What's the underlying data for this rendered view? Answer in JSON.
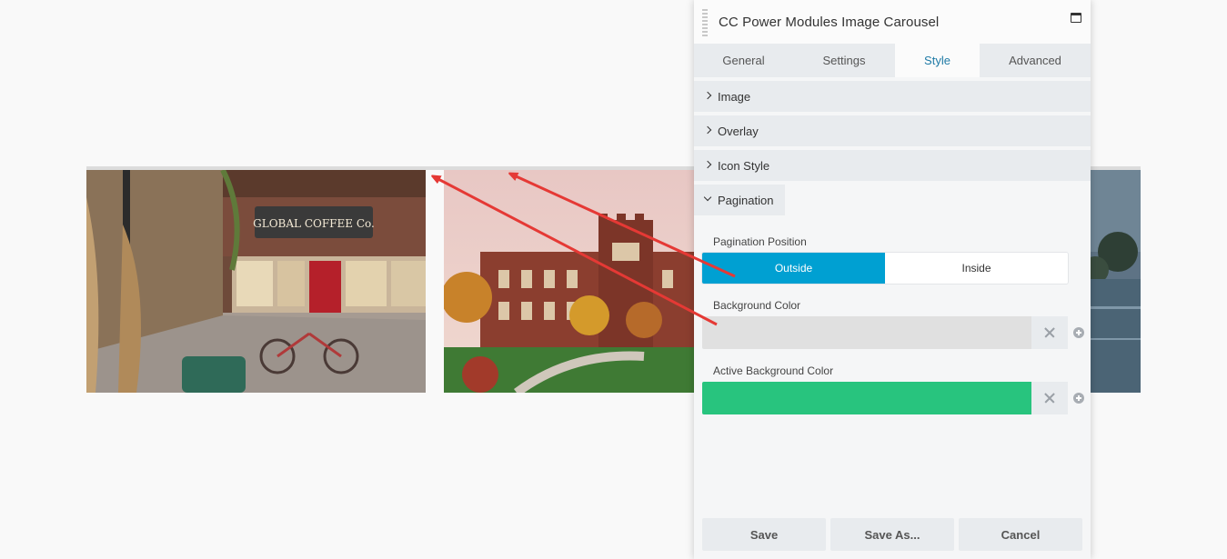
{
  "panel": {
    "title": "CC Power Modules Image Carousel",
    "tabs": [
      {
        "label": "General"
      },
      {
        "label": "Settings"
      },
      {
        "label": "Style",
        "active": true
      },
      {
        "label": "Advanced"
      }
    ],
    "sections": [
      {
        "label": "Image",
        "expanded": false
      },
      {
        "label": "Overlay",
        "expanded": false
      },
      {
        "label": "Icon Style",
        "expanded": false
      },
      {
        "label": "Pagination",
        "expanded": true
      }
    ],
    "pagination": {
      "position_label": "Pagination Position",
      "options": [
        "Outside",
        "Inside"
      ],
      "selected": "Outside",
      "bg_color_label": "Background Color",
      "bg_color": "#e0e0e0",
      "active_bg_color_label": "Active Background Color",
      "active_bg_color": "#28c47e"
    },
    "footer": {
      "save": "Save",
      "save_as": "Save As...",
      "cancel": "Cancel"
    }
  },
  "carousel": {
    "slides": [
      {
        "sign_text": "GLOBAL COFFEE Co."
      },
      {},
      {}
    ]
  },
  "colors": {
    "accent": "#00a0d2",
    "active_tab_text": "#1f7aa6",
    "annotation_arrow": "#e53935"
  }
}
